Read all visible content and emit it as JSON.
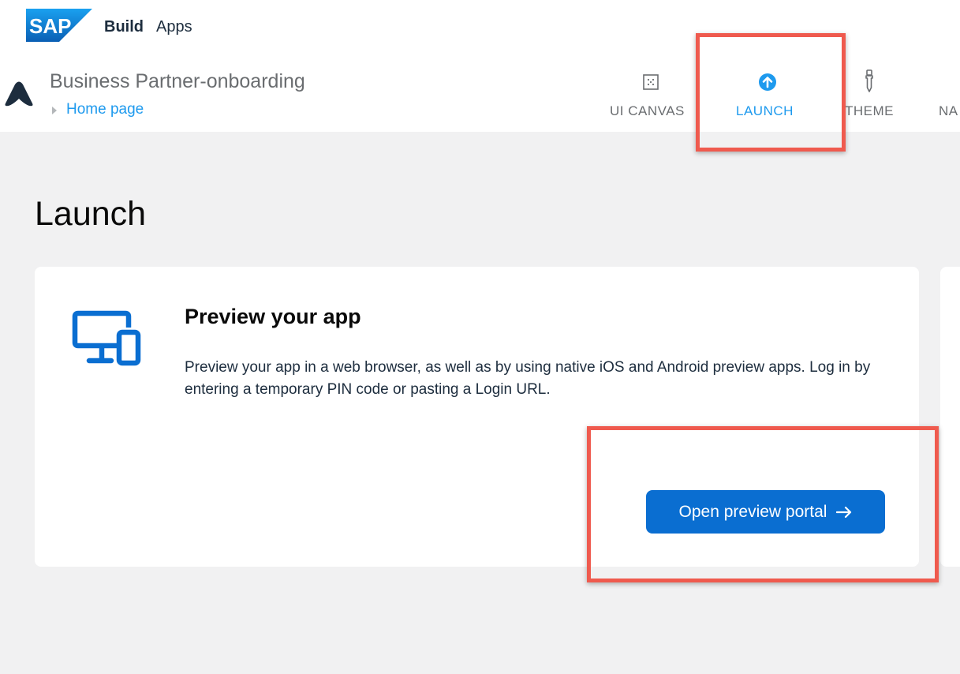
{
  "header": {
    "brand_logo_text": "SAP",
    "product_primary": "Build",
    "product_secondary": "Apps"
  },
  "project": {
    "title": "Business Partner-onboarding",
    "breadcrumb": "Home page"
  },
  "tabs": [
    {
      "label": "UI CANVAS",
      "icon": "grid-canvas-icon",
      "active": false
    },
    {
      "label": "LAUNCH",
      "icon": "upload-arrow-icon",
      "active": true
    },
    {
      "label": "THEME",
      "icon": "dropper-icon",
      "active": false
    },
    {
      "label": "NA",
      "icon": "",
      "active": false
    }
  ],
  "page": {
    "heading": "Launch"
  },
  "preview_card": {
    "icon": "devices-icon",
    "title": "Preview your app",
    "description": "Preview your app in a web browser, as well as by using native iOS and Android preview apps. Log in by entering a temporary PIN code or pasting a Login URL.",
    "button_label": "Open preview portal",
    "button_icon": "arrow-right-icon"
  },
  "colors": {
    "accent": "#1e9aee",
    "button": "#0a6ed1",
    "highlight": "#ef5a4e",
    "background": "#f1f1f2"
  }
}
